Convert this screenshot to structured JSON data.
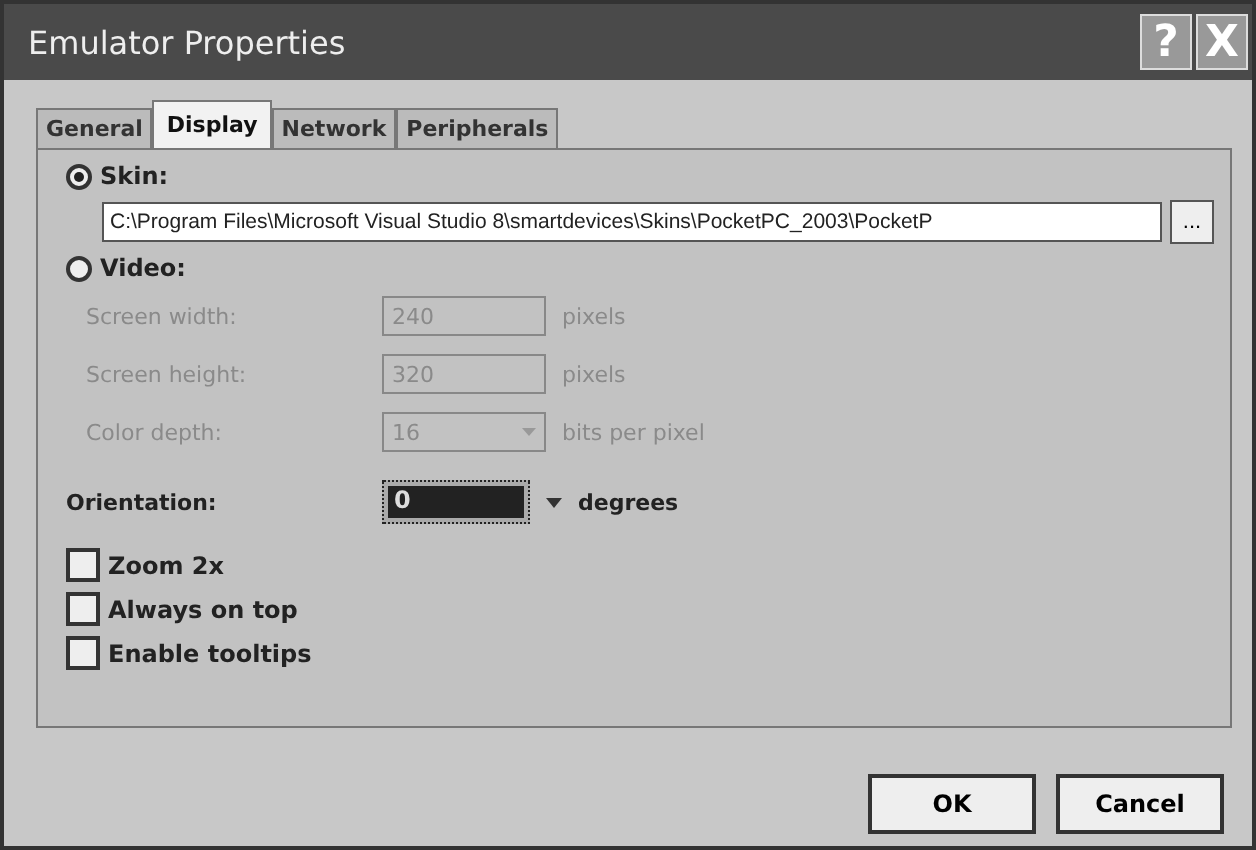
{
  "window": {
    "title": "Emulator Properties",
    "help": "?",
    "close": "X"
  },
  "tabs": [
    {
      "label": "General",
      "selected": false
    },
    {
      "label": "Display",
      "selected": true
    },
    {
      "label": "Network",
      "selected": false
    },
    {
      "label": "Peripherals",
      "selected": false
    }
  ],
  "skin": {
    "label": "Skin:",
    "selected": true,
    "path": "C:\\Program Files\\Microsoft Visual Studio 8\\smartdevices\\Skins\\PocketPC_2003\\PocketP",
    "browse": "..."
  },
  "video": {
    "label": "Video:",
    "selected": false,
    "fields": [
      {
        "label": "Screen width:",
        "value": "240",
        "unit": "pixels",
        "kind": "text"
      },
      {
        "label": "Screen height:",
        "value": "320",
        "unit": "pixels",
        "kind": "text"
      },
      {
        "label": "Color depth:",
        "value": "16",
        "unit": "bits per pixel",
        "kind": "dropdown"
      }
    ]
  },
  "orientation": {
    "label": "Orientation:",
    "value": "0",
    "unit": "degrees"
  },
  "checkboxes": [
    {
      "label": "Zoom 2x",
      "checked": false
    },
    {
      "label": "Always on top",
      "checked": false
    },
    {
      "label": "Enable tooltips",
      "checked": false
    }
  ],
  "buttons": [
    "OK",
    "Cancel"
  ]
}
